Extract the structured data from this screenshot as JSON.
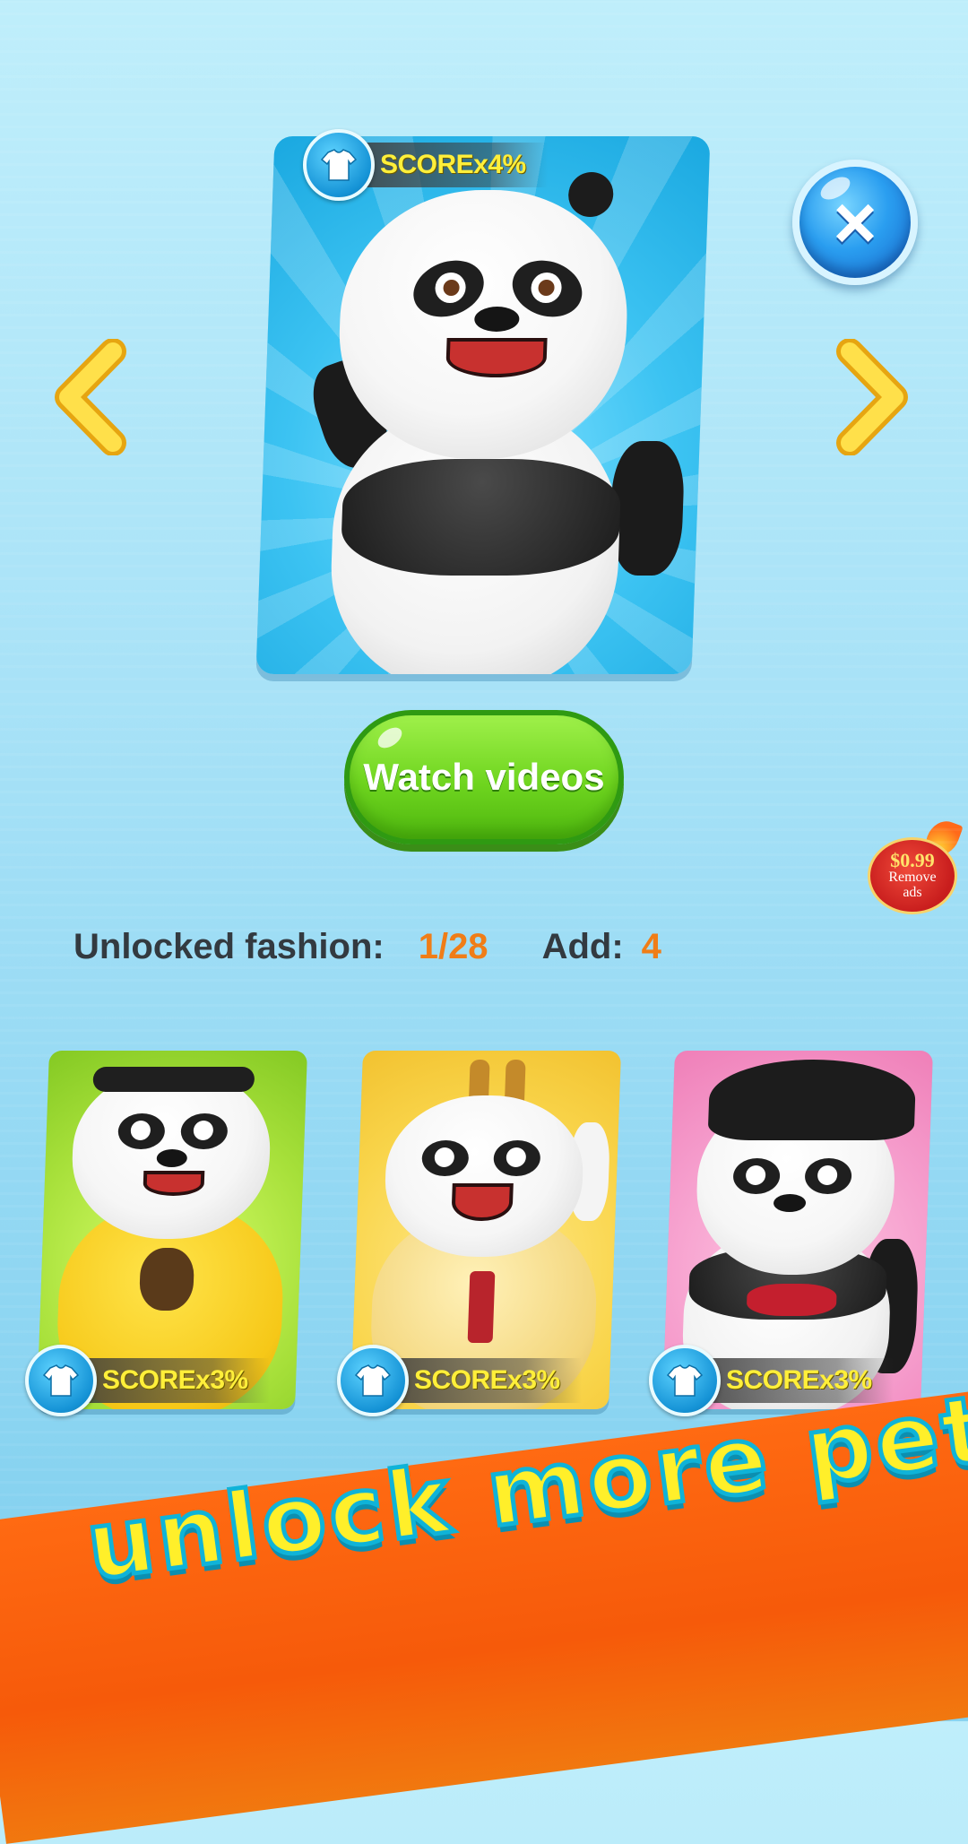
{
  "main_card": {
    "score_label": "SCOREx4%"
  },
  "navigation": {
    "prev_icon": "chevron-left-icon",
    "next_icon": "chevron-right-icon",
    "close_icon": "close-icon",
    "close_symbol": "×"
  },
  "actions": {
    "watch_videos_label": "Watch videos"
  },
  "remove_ads": {
    "price": "$0.99",
    "label_line1": "Remove",
    "label_line2": "ads"
  },
  "stats": {
    "unlocked_label": "Unlocked fashion:",
    "unlocked_value": "1/28",
    "add_label": "Add:",
    "add_value": "4"
  },
  "outfits": [
    {
      "score_label": "SCOREx3%"
    },
    {
      "score_label": "SCOREx3%"
    },
    {
      "score_label": "SCOREx3%"
    }
  ],
  "banner": {
    "text": "unlock more pets"
  },
  "colors": {
    "accent_orange": "#f07d17",
    "score_yellow": "#ffef3a",
    "button_green": "#6fd51f",
    "banner_orange": "#f65a0a"
  }
}
